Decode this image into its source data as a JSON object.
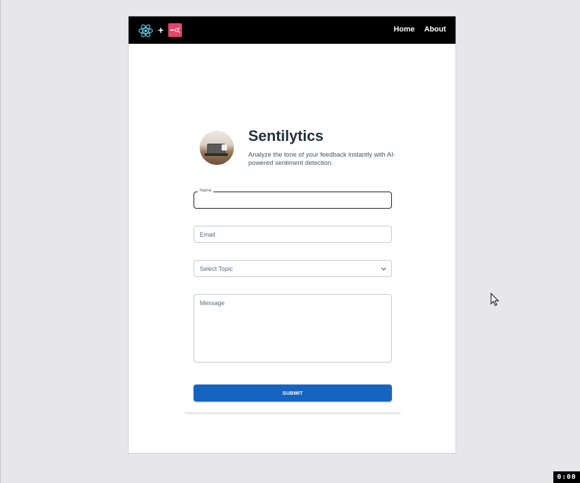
{
  "navbar": {
    "plus": "+",
    "links": [
      {
        "label": "Home"
      },
      {
        "label": "About"
      }
    ]
  },
  "header": {
    "title": "Sentilytics",
    "subtitle": "Analyze the tone of your feedback instantly with AI-powered sentiment detection."
  },
  "form": {
    "name_label": "Name",
    "name_value": "",
    "email_placeholder": "Email",
    "topic_placeholder": "Select Topic",
    "message_placeholder": "Message",
    "submit_label": "SUBMIT"
  },
  "timer": "0:00",
  "colors": {
    "navbar_bg": "#000000",
    "submit_bg": "#1565c0",
    "brand_icon_bg": "#e0466a",
    "page_bg": "#e7e6eb"
  }
}
